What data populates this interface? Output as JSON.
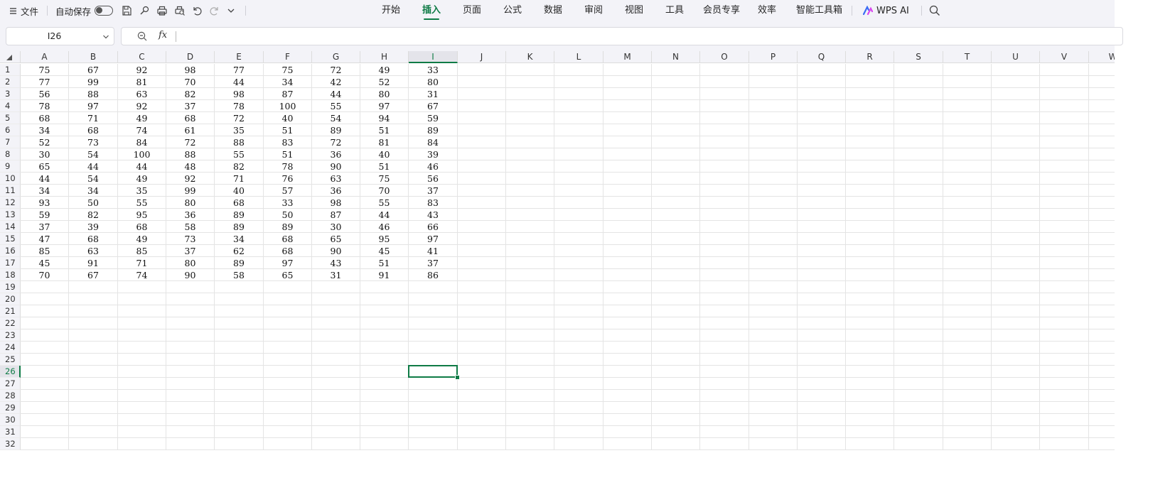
{
  "menubar": {
    "file_label": "文件",
    "autosave_label": "自动保存",
    "tabs": [
      {
        "label": "开始",
        "active": false
      },
      {
        "label": "插入",
        "active": true
      },
      {
        "label": "页面",
        "active": false
      },
      {
        "label": "公式",
        "active": false
      },
      {
        "label": "数据",
        "active": false
      },
      {
        "label": "审阅",
        "active": false
      },
      {
        "label": "视图",
        "active": false
      },
      {
        "label": "工具",
        "active": false
      },
      {
        "label": "会员专享",
        "active": false
      },
      {
        "label": "效率",
        "active": false
      },
      {
        "label": "智能工具箱",
        "active": false
      }
    ],
    "wps_ai_label": "WPS AI",
    "accent_color": "#0f7b46"
  },
  "formula_bar": {
    "name_box": "I26",
    "fx_label": "fx",
    "formula": ""
  },
  "sheet": {
    "columns": [
      "A",
      "B",
      "C",
      "D",
      "E",
      "F",
      "G",
      "H",
      "I",
      "J",
      "K",
      "L",
      "M",
      "N",
      "O",
      "P",
      "Q",
      "R",
      "S",
      "T",
      "U",
      "V",
      "W"
    ],
    "row_count": 32,
    "selected_cell": {
      "col": "I",
      "row": 26
    },
    "rows": [
      [
        75,
        67,
        92,
        98,
        77,
        75,
        72,
        49,
        33
      ],
      [
        77,
        99,
        81,
        70,
        44,
        34,
        42,
        52,
        80
      ],
      [
        56,
        88,
        63,
        82,
        98,
        87,
        44,
        80,
        31
      ],
      [
        78,
        97,
        92,
        37,
        78,
        100,
        55,
        97,
        67
      ],
      [
        68,
        71,
        49,
        68,
        72,
        40,
        54,
        94,
        59
      ],
      [
        34,
        68,
        74,
        61,
        35,
        51,
        89,
        51,
        89
      ],
      [
        52,
        73,
        84,
        72,
        88,
        83,
        72,
        81,
        84
      ],
      [
        30,
        54,
        100,
        88,
        55,
        51,
        36,
        40,
        39
      ],
      [
        65,
        44,
        44,
        48,
        82,
        78,
        90,
        51,
        46
      ],
      [
        44,
        54,
        49,
        92,
        71,
        76,
        63,
        75,
        56
      ],
      [
        34,
        34,
        35,
        99,
        40,
        57,
        36,
        70,
        37
      ],
      [
        93,
        50,
        55,
        80,
        68,
        33,
        98,
        55,
        83
      ],
      [
        59,
        82,
        95,
        36,
        89,
        50,
        87,
        44,
        43
      ],
      [
        37,
        39,
        68,
        58,
        89,
        89,
        30,
        46,
        66
      ],
      [
        47,
        68,
        49,
        73,
        34,
        68,
        65,
        95,
        97
      ],
      [
        85,
        63,
        85,
        37,
        62,
        68,
        90,
        45,
        41
      ],
      [
        45,
        91,
        71,
        80,
        89,
        97,
        43,
        51,
        37
      ],
      [
        70,
        67,
        74,
        90,
        58,
        65,
        31,
        91,
        86
      ]
    ]
  }
}
